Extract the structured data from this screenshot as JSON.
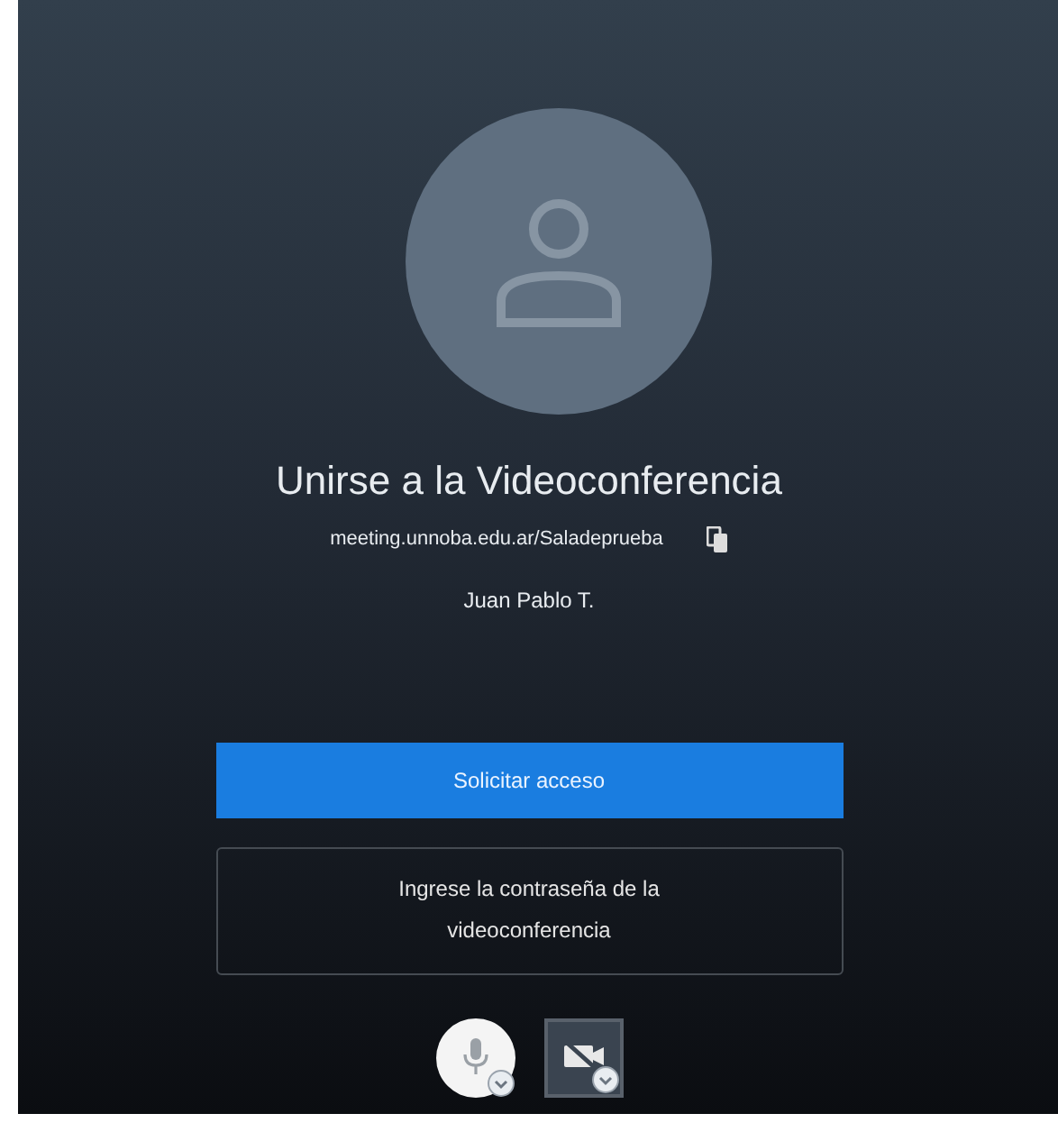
{
  "title": "Unirse a la Videoconferencia",
  "meeting_link": "meeting.unnoba.edu.ar/Saladeprueba",
  "user_name": "Juan Pablo T.",
  "buttons": [
    {
      "kind": "primary",
      "label": "Solicitar acceso"
    },
    {
      "kind": "outline",
      "label": "Ingrese la contraseña de la videoconferencia"
    }
  ],
  "media_controls": [
    {
      "kind": "microphone",
      "on": true
    },
    {
      "kind": "camera",
      "on": false
    }
  ]
}
